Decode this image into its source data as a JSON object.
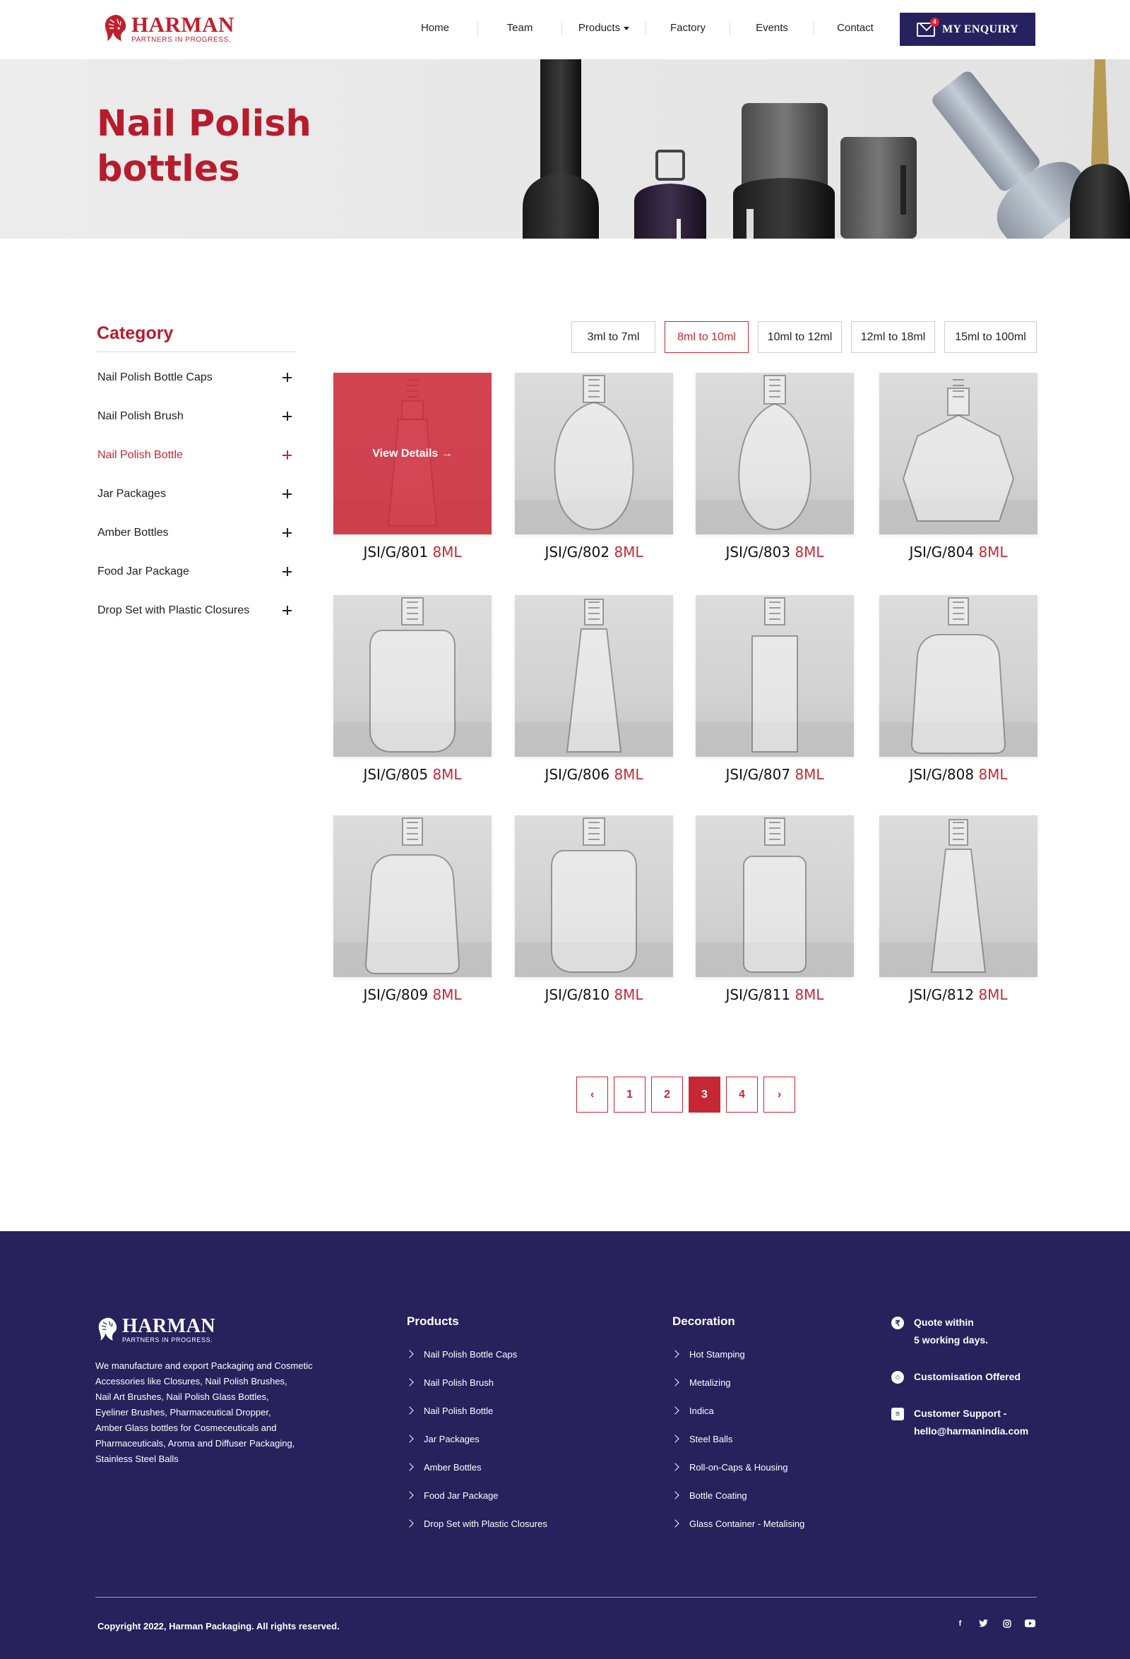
{
  "header": {
    "logo": {
      "name": "HARMAN",
      "tagline": "PARTNERS IN PROGRESS."
    },
    "nav": [
      "Home",
      "Team",
      "Products",
      "Factory",
      "Events",
      "Contact"
    ],
    "enquiry_label": "MY ENQUIRY",
    "enquiry_count": "4"
  },
  "hero": {
    "title_line1": "Nail Polish",
    "title_line2": "bottles"
  },
  "sidebar": {
    "title": "Category",
    "items": [
      {
        "label": "Nail Polish Bottle Caps",
        "active": false
      },
      {
        "label": "Nail Polish Brush",
        "active": false
      },
      {
        "label": "Nail Polish Bottle",
        "active": true
      },
      {
        "label": "Jar Packages",
        "active": false
      },
      {
        "label": "Amber Bottles",
        "active": false
      },
      {
        "label": "Food Jar Package",
        "active": false
      },
      {
        "label": "Drop Set with Plastic Closures",
        "active": false
      }
    ]
  },
  "filters": [
    {
      "label": "3ml to 7ml",
      "active": false
    },
    {
      "label": "8ml to 10ml",
      "active": true
    },
    {
      "label": "10ml to 12ml",
      "active": false
    },
    {
      "label": "12ml to 18ml",
      "active": false
    },
    {
      "label": "15ml to 100ml",
      "active": false
    }
  ],
  "products": [
    {
      "code": "JSI/G/801",
      "size": "8ML",
      "hover_label": "View Details",
      "shape": "tall-taper"
    },
    {
      "code": "JSI/G/802",
      "size": "8ML",
      "shape": "oval"
    },
    {
      "code": "JSI/G/803",
      "size": "8ML",
      "shape": "oval-tall"
    },
    {
      "code": "JSI/G/804",
      "size": "8ML",
      "shape": "hexagon"
    },
    {
      "code": "JSI/G/805",
      "size": "8ML",
      "shape": "round-square"
    },
    {
      "code": "JSI/G/806",
      "size": "8ML",
      "shape": "slim-taper"
    },
    {
      "code": "JSI/G/807",
      "size": "8ML",
      "shape": "cylinder"
    },
    {
      "code": "JSI/G/808",
      "size": "8ML",
      "shape": "bell"
    },
    {
      "code": "JSI/G/809",
      "size": "8ML",
      "shape": "bell"
    },
    {
      "code": "JSI/G/810",
      "size": "8ML",
      "shape": "round-square"
    },
    {
      "code": "JSI/G/811",
      "size": "8ML",
      "shape": "shoulder"
    },
    {
      "code": "JSI/G/812",
      "size": "8ML",
      "shape": "slim-taper"
    }
  ],
  "pagination": {
    "pages": [
      "1",
      "2",
      "3",
      "4"
    ],
    "current": "3",
    "prev": "‹",
    "next": "›"
  },
  "footer": {
    "about": "We manufacture and export Packaging and Cosmetic\n Accessories like Closures, Nail Polish Brushes,\nNail Art Brushes, Nail Polish Glass Bottles,\nEyeliner Brushes, Pharmaceutical Dropper,\nAmber Glass bottles for Cosmeceuticals and\nPharmaceuticals, Aroma and Diffuser Packaging,\nStainless Steel Balls",
    "products_title": "Products",
    "products": [
      "Nail Polish Bottle Caps",
      "Nail Polish Brush",
      "Nail Polish Bottle",
      "Jar Packages",
      "Amber Bottles",
      "Food Jar Package",
      "Drop Set with Plastic Closures"
    ],
    "decoration_title": "Decoration",
    "decoration": [
      "Hot Stamping",
      "Metalizing",
      "Indica",
      "Steel Balls",
      "Roll-on-Caps & Housing",
      "Bottle Coating",
      "Glass Container - Metalising"
    ],
    "info": [
      {
        "icon": "rupee-icon",
        "glyph": "₹",
        "text": "Quote within\n5 working days."
      },
      {
        "icon": "lock-icon",
        "glyph": "🔒",
        "text": "Customisation Offered"
      },
      {
        "icon": "chat-icon",
        "glyph": "✉",
        "text": "Customer Support -\nhello@harmanindia.com"
      }
    ],
    "copyright": "Copyright 2022, Harman Packaging. All rights reserved.",
    "social": [
      "f",
      "t",
      "ig",
      "yt"
    ]
  },
  "colors": {
    "brand_red": "#c62833",
    "navy": "#27215c"
  }
}
